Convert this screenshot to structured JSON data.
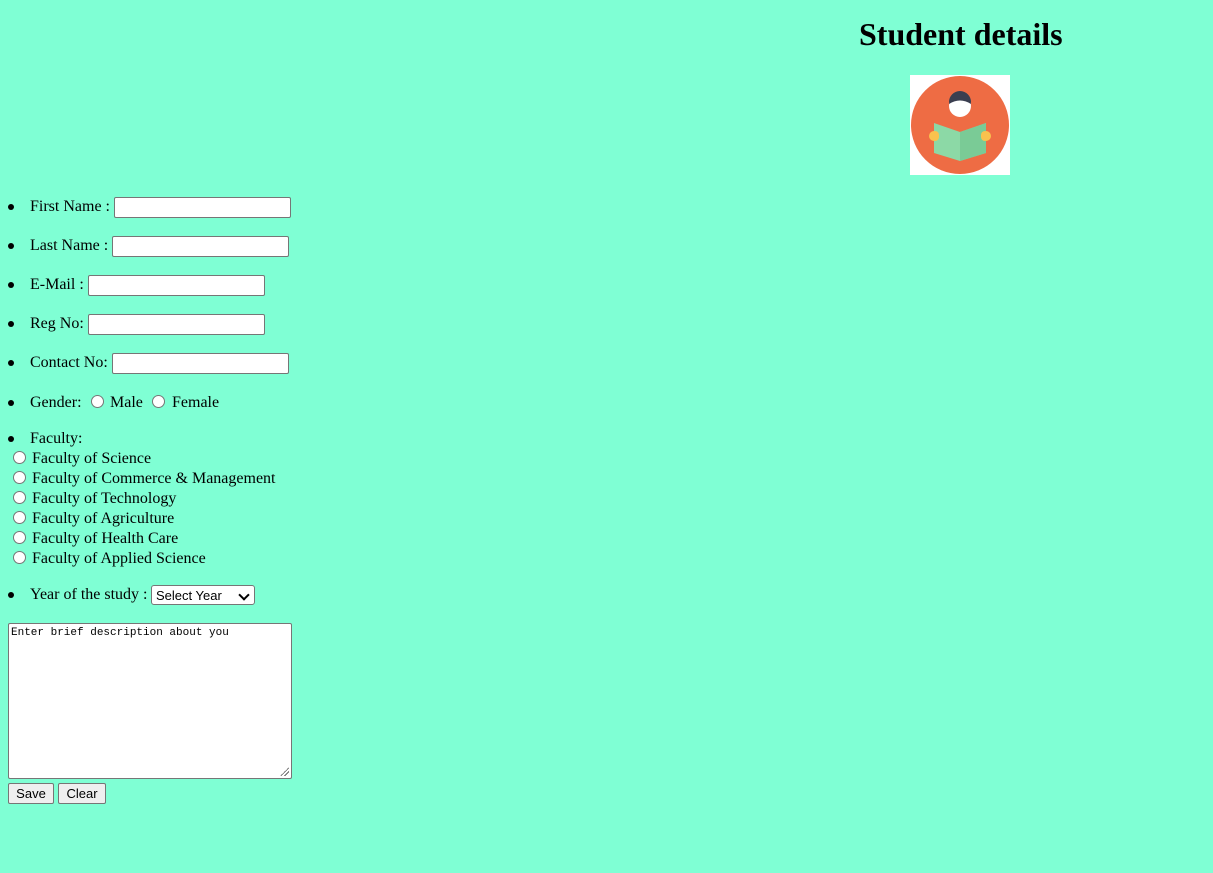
{
  "page": {
    "title": "Student details"
  },
  "form": {
    "first_name": {
      "label": "First Name :",
      "value": ""
    },
    "last_name": {
      "label": "Last Name :",
      "value": ""
    },
    "email": {
      "label": "E-Mail :",
      "value": ""
    },
    "reg_no": {
      "label": "Reg No:",
      "value": ""
    },
    "contact_no": {
      "label": "Contact No:",
      "value": ""
    },
    "gender": {
      "label": "Gender:",
      "options": [
        "Male",
        "Female"
      ]
    },
    "faculty": {
      "label": "Faculty:",
      "options": [
        "Faculty of Science",
        "Faculty of Commerce & Management",
        "Faculty of Technology",
        "Faculty of Agriculture",
        "Faculty of Health Care",
        "Faculty of Applied Science"
      ]
    },
    "year": {
      "label": "Year of the study :",
      "selected": "Select Year"
    },
    "description": {
      "placeholder": "Enter brief description about you"
    },
    "save_label": "Save",
    "clear_label": "Clear"
  },
  "colors": {
    "background": "#7fffd4",
    "logo_circle": "#ee6c44",
    "book": "#8cd9a6"
  },
  "icons": {
    "logo": "student-reading-icon"
  }
}
